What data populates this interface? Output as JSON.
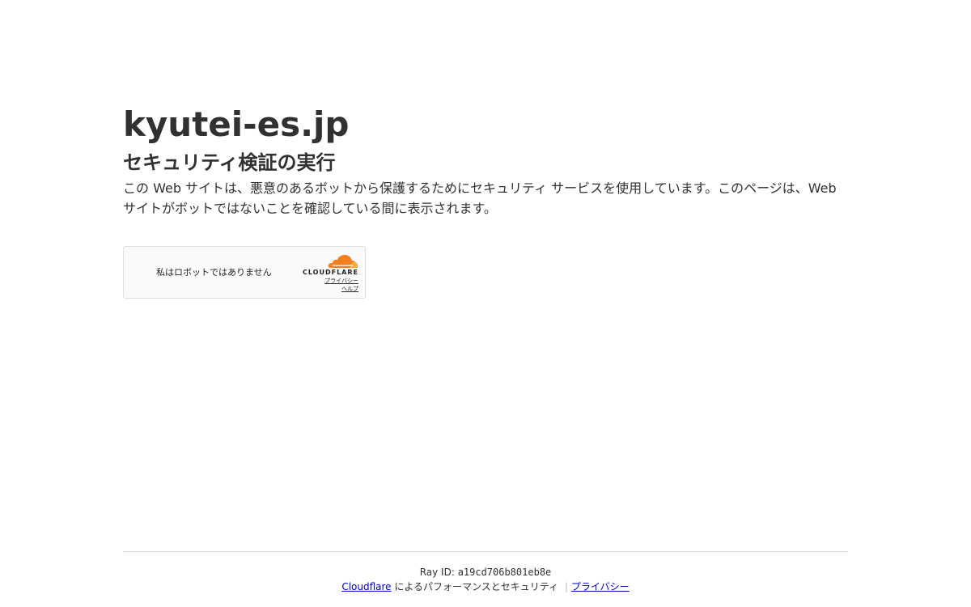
{
  "header": {
    "site_name": "kyutei-es.jp",
    "subtitle": "セキュリティ検証の実行",
    "description": "この Web サイトは、悪意のあるボットから保護するためにセキュリティ サービスを使用しています。このページは、Web サイトがボットではないことを確認している間に表示されます。"
  },
  "widget": {
    "checkbox_label": "私はロボットではありません",
    "brand": "CLOUDFLARE",
    "privacy_link": "プライバシー",
    "help_link": "ヘルプ",
    "brand_colors": {
      "cloud_orange": "#f38020",
      "cloud_light": "#faae40"
    }
  },
  "footer": {
    "ray_label": "Ray ID: ",
    "ray_id": "a19cd706b801eb8e",
    "cloudflare_link": "Cloudflare",
    "performance_text": " によるパフォーマンスとセキュリティ ",
    "separator": "|",
    "privacy_link": "プライバシー"
  },
  "colors": {
    "text": "#313131",
    "link": "#0000cc",
    "divider": "#d9d9d9",
    "widget_bg": "#fafafa"
  }
}
